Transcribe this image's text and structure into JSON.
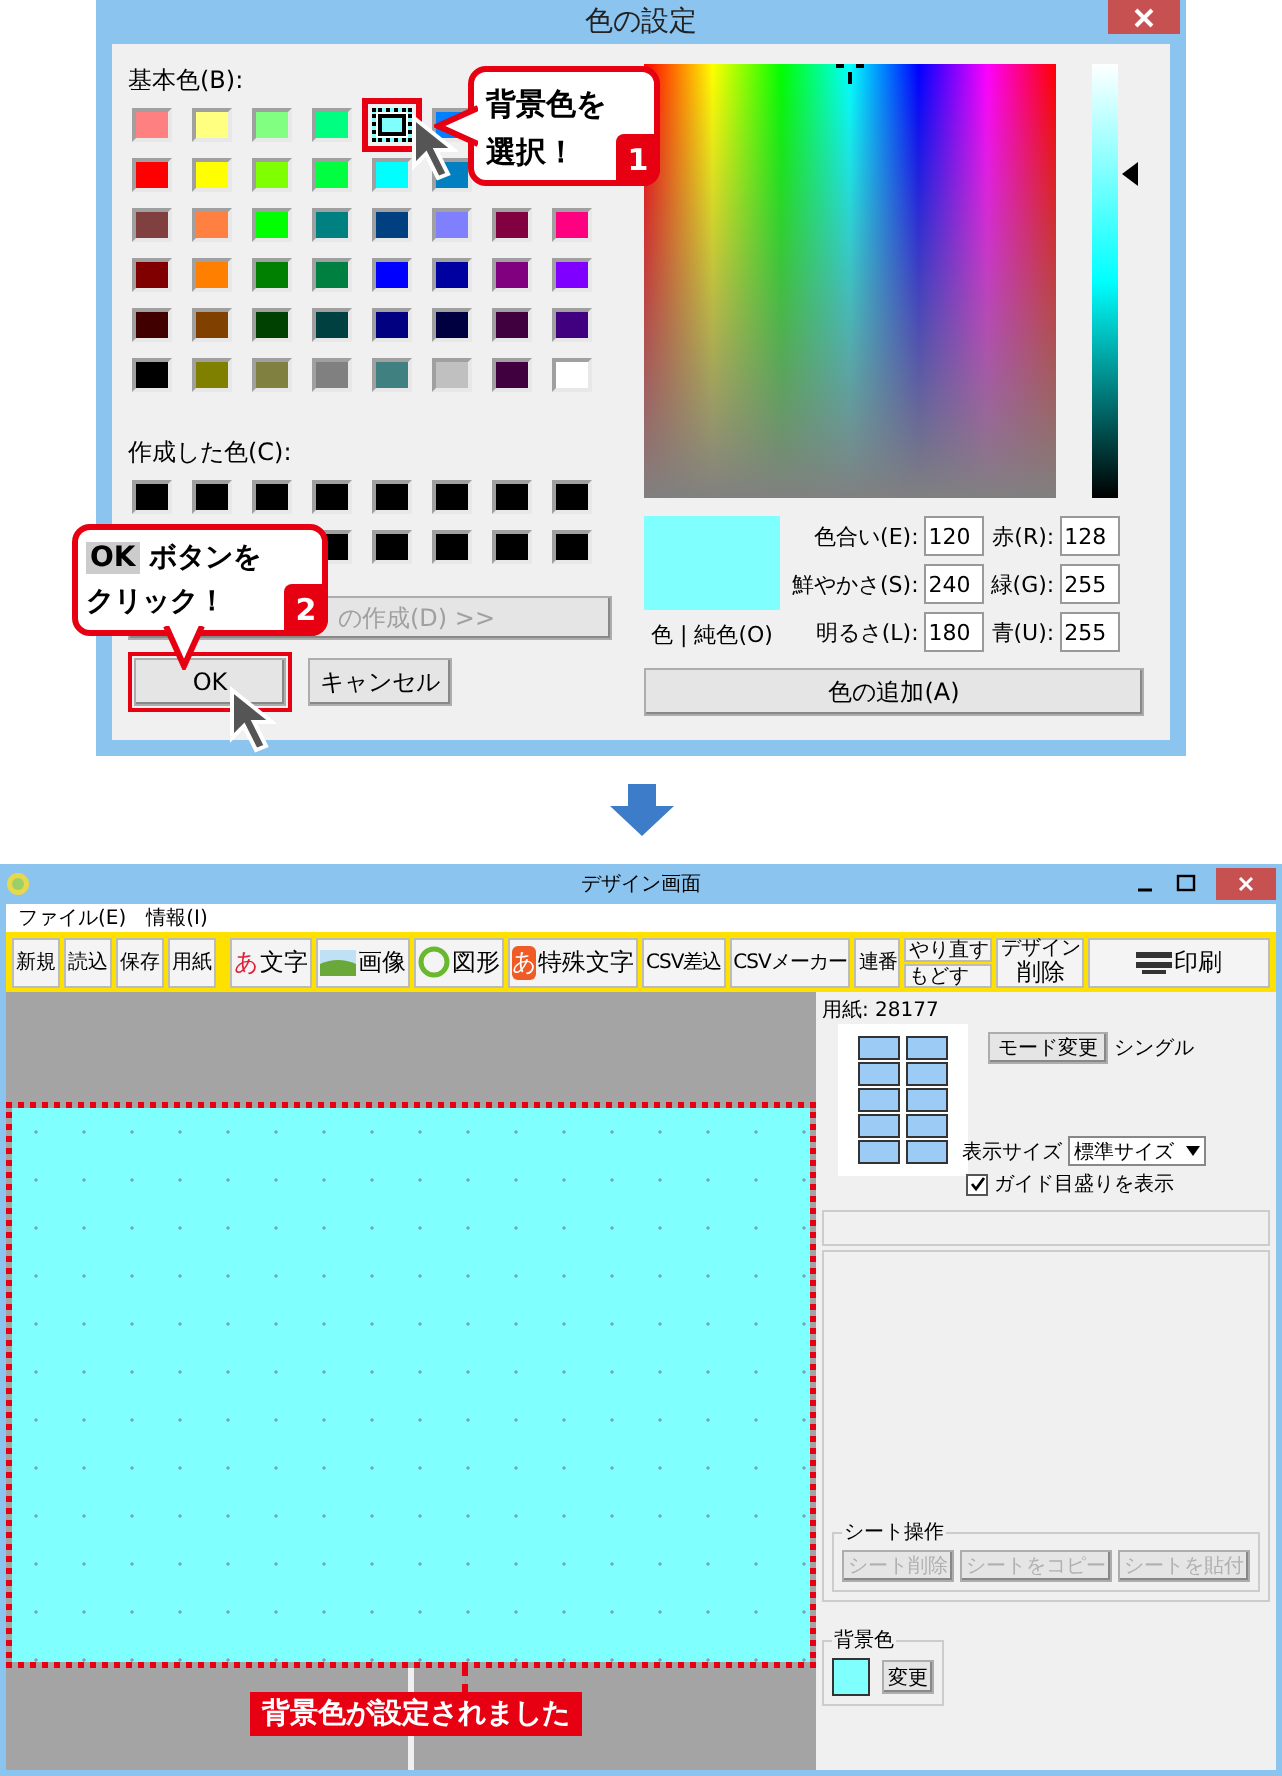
{
  "dialog": {
    "title": "色の設定",
    "basic_colors_label": "基本色(B):",
    "basic_colors": [
      {
        "swatches": [
          {
            "color": "#ff8080",
            "selected": false
          },
          {
            "color": "#ffff80",
            "selected": false
          },
          {
            "color": "#80ff80",
            "selected": false
          },
          {
            "color": "#00ff80",
            "selected": false
          },
          {
            "color": "#80ffff",
            "selected": true
          },
          {
            "color": "#0080ff",
            "selected": false
          }
        ]
      },
      {
        "swatches": [
          {
            "color": "#ff0000",
            "selected": false
          },
          {
            "color": "#ffff00",
            "selected": false
          },
          {
            "color": "#80ff00",
            "selected": false
          },
          {
            "color": "#00ff40",
            "selected": false
          },
          {
            "color": "#00ffff",
            "selected": false
          },
          {
            "color": "#0080c0",
            "selected": false
          }
        ]
      },
      {
        "swatches": [
          {
            "color": "#804040",
            "selected": false
          },
          {
            "color": "#ff8040",
            "selected": false
          },
          {
            "color": "#00ff00",
            "selected": false
          },
          {
            "color": "#008080",
            "selected": false
          },
          {
            "color": "#004080",
            "selected": false
          },
          {
            "color": "#8080ff",
            "selected": false
          },
          {
            "color": "#800040",
            "selected": false
          },
          {
            "color": "#ff0080",
            "selected": false
          }
        ]
      },
      {
        "swatches": [
          {
            "color": "#800000",
            "selected": false
          },
          {
            "color": "#ff8000",
            "selected": false
          },
          {
            "color": "#008000",
            "selected": false
          },
          {
            "color": "#008040",
            "selected": false
          },
          {
            "color": "#0000ff",
            "selected": false
          },
          {
            "color": "#0000a0",
            "selected": false
          },
          {
            "color": "#800080",
            "selected": false
          },
          {
            "color": "#8000ff",
            "selected": false
          }
        ]
      },
      {
        "swatches": [
          {
            "color": "#400000",
            "selected": false
          },
          {
            "color": "#804000",
            "selected": false
          },
          {
            "color": "#004000",
            "selected": false
          },
          {
            "color": "#004040",
            "selected": false
          },
          {
            "color": "#000080",
            "selected": false
          },
          {
            "color": "#000040",
            "selected": false
          },
          {
            "color": "#400040",
            "selected": false
          },
          {
            "color": "#400080",
            "selected": false
          }
        ]
      },
      {
        "swatches": [
          {
            "color": "#000000",
            "selected": false
          },
          {
            "color": "#808000",
            "selected": false
          },
          {
            "color": "#808040",
            "selected": false
          },
          {
            "color": "#808080",
            "selected": false
          },
          {
            "color": "#408080",
            "selected": false
          },
          {
            "color": "#c0c0c0",
            "selected": false
          },
          {
            "color": "#400040",
            "selected": false
          },
          {
            "color": "#ffffff",
            "selected": false
          }
        ]
      }
    ],
    "custom_colors_label": "作成した色(C):",
    "custom_colors": [
      {
        "swatches": [
          {
            "color": "#000000"
          },
          {
            "color": "#000000"
          },
          {
            "color": "#000000"
          },
          {
            "color": "#000000"
          },
          {
            "color": "#000000"
          },
          {
            "color": "#000000"
          },
          {
            "color": "#000000"
          },
          {
            "color": "#000000"
          }
        ]
      },
      {
        "swatches": [
          {
            "color": "#000000"
          },
          {
            "color": "#000000"
          },
          {
            "color": "#000000"
          },
          {
            "color": "#000000"
          },
          {
            "color": "#000000"
          }
        ]
      }
    ],
    "define_button": {
      "label": "の作成(D) >>",
      "disabled": true
    },
    "ok_button": "OK",
    "cancel_button": "キャンセル",
    "preview_label": "色 | 純色(O)",
    "fields": [
      {
        "label": "色合い(E):",
        "value": "120"
      },
      {
        "label": "赤(R):",
        "value": "128"
      },
      {
        "label": "鮮やかさ(S):",
        "value": "240"
      },
      {
        "label": "緑(G):",
        "value": "255"
      },
      {
        "label": "明るさ(L):",
        "value": "180"
      },
      {
        "label": "青(U):",
        "value": "255"
      }
    ],
    "add_button": "色の追加(A)"
  },
  "callouts": [
    {
      "lines": [
        "背景色を",
        "選択！"
      ],
      "number": "1"
    },
    {
      "key_label": "OK",
      "lines": [
        "ボタンを",
        "クリック！"
      ],
      "number": "2"
    }
  ],
  "design_window": {
    "title": "デザイン画面",
    "menu": [
      "ファイル(E)",
      "情報(I)"
    ],
    "toolbar": [
      {
        "kind": "plain",
        "label": "新規"
      },
      {
        "kind": "plain",
        "label": "読込"
      },
      {
        "kind": "plain",
        "label": "保存"
      },
      {
        "kind": "plain",
        "label": "用紙"
      },
      {
        "kind": "glyph",
        "glyph": "あ",
        "label": "文字"
      },
      {
        "kind": "image",
        "label": "画像"
      },
      {
        "kind": "shape",
        "label": "図形"
      },
      {
        "kind": "glyph",
        "glyph": "あ",
        "label": "特殊文字"
      },
      {
        "kind": "plain",
        "label": "CSV差込"
      },
      {
        "kind": "plain",
        "label": "CSVメーカー"
      },
      {
        "kind": "plain",
        "label": "連番"
      },
      {
        "kind": "stack",
        "label": "やり直す",
        "sublabel": "もどす"
      },
      {
        "kind": "caption",
        "caption": "デザイン",
        "label": "削除"
      },
      {
        "kind": "print",
        "label": "印刷"
      }
    ],
    "paper_label": "用紙: 28177",
    "mode_button": "モード変更",
    "mode_value": "シングル",
    "size_label": "表示サイズ",
    "size_value": "標準サイズ",
    "guide": {
      "label": "ガイド目盛りを表示",
      "checked": true
    },
    "sheet_group": {
      "title": "シート操作",
      "buttons": [
        {
          "label": "シート削除",
          "disabled": true
        },
        {
          "label": "シートをコピー",
          "disabled": true
        },
        {
          "label": "シートを貼付",
          "disabled": true
        }
      ]
    },
    "background_group": {
      "title": "背景色",
      "button": "変更"
    }
  },
  "caption": "背景色が設定されました"
}
